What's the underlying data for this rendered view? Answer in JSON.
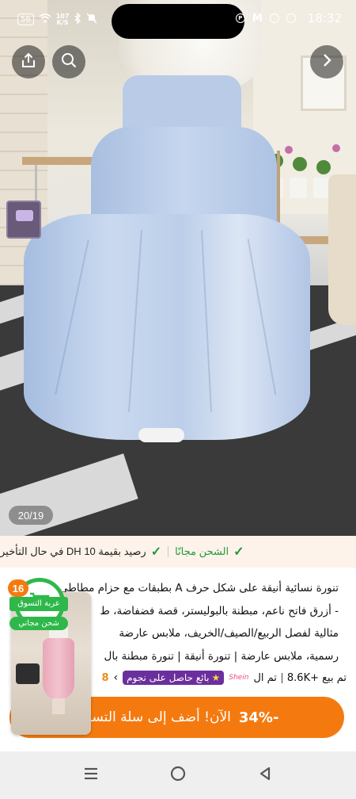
{
  "status_bar": {
    "signal_badge": "56",
    "net_speed_top": "107",
    "net_speed_bottom": "K/S",
    "time": "18:32",
    "icons": [
      "wifi-icon",
      "bluetooth-icon",
      "mute-icon",
      "pinterest-icon",
      "gmail-icon",
      "chrome-icon",
      "alarm-icon"
    ]
  },
  "top_actions": {
    "share_icon": "share-icon",
    "search_icon": "search-icon",
    "forward_icon": "chevron-right-icon"
  },
  "gallery": {
    "counter": "20/19"
  },
  "shipping": {
    "free_shipping": "الشحن مجانًا",
    "credit_note": "رصيد بقيمة 10 DH في حال التأخير"
  },
  "product": {
    "description_lines": [
      "تنورة نسائية أنيقة على شكل حرف A بطبقات مع حزام مطاطي",
      "- أزرق فاتح ناعم، مبطنة بالبوليستر، قصة فضفاضة، ط",
      "مثالية لفصل الربيع/الصيف/الخريف، ملابس عارضة",
      "رسمية، ملابس عارضة | تنورة أنيقة | تنورة مبطنة بال"
    ],
    "sold": "تم بيع +8.6K",
    "sold_suffix": "تم ال",
    "star_seller": "بائع حاصل على نجوم",
    "rating": "8"
  },
  "cta": {
    "discount": "-34%",
    "label": "الآن! أضف إلى سلة التسوق"
  },
  "cart": {
    "count": "16",
    "label": "عربة التسوق",
    "free_shipping": "شحن مجاني"
  },
  "navbar": {
    "icons": [
      "menu-icon",
      "home-icon",
      "back-icon"
    ]
  },
  "colors": {
    "accent_orange": "#f47a10",
    "success_green": "#1f9a3b",
    "cart_green": "#2fb84a",
    "star_purple": "#6b2f9d"
  }
}
